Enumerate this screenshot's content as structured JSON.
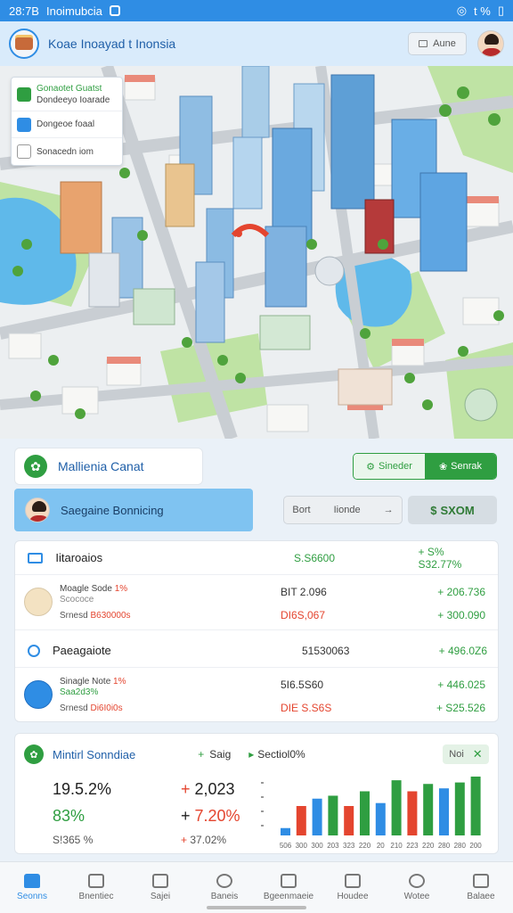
{
  "status_bar": {
    "time": "28:7B",
    "app_name": "Inoimubcia",
    "right_text": "t %"
  },
  "header": {
    "title": "Koae Inoayad t Inonsia",
    "button_label": "Aune"
  },
  "map_card": {
    "row1_top": "Gonaotet Guatst",
    "row1_bottom": "Dondeeyo Ioarade",
    "row2": "Dongeoe foaal",
    "row3": "Sonacedn iom"
  },
  "actions": {
    "card_label": "Mallienia Canat",
    "seg_left": "Sineder",
    "seg_right": "Senrak",
    "profile_label": "Saegaine Bonnicing",
    "ctl_left": "Bort",
    "ctl_mid": "Iionde",
    "ctl_right": "SXOM",
    "ctl_right_icon": "$"
  },
  "transactions": {
    "header1": {
      "name": "Iitaroaios",
      "mid": "S.S6600",
      "right": "+ S% S32.77%"
    },
    "item1": {
      "t1": "Moagle Sode",
      "t1_neg": "1%",
      "t2": "Scococe",
      "t3": "Srnesd",
      "t3_neg": "B630000s",
      "v1": "BIT 2.096",
      "v2": "DI6S,067",
      "r1": "+ 206.736",
      "r2": "+ 300.090"
    },
    "header2": {
      "name": "Paeagaiote",
      "mid": "51530063",
      "right": "+ 496.0Z6"
    },
    "item2": {
      "t1": "Sinagle Note",
      "t1_neg": "1%",
      "t2": "Saa2d3%",
      "t3": "Srnesd",
      "t3_neg": "Di6I0i0s",
      "v1": "5I6.5S60",
      "v2": "DIE S.S6S",
      "r1": "+ 446.025",
      "r2": "+ S25.526"
    }
  },
  "stats": {
    "title": "Mintirl Sonndiae",
    "h2": "Saig",
    "h3": "Sectiol0%",
    "chip": "Noi",
    "s1": "19.5.2%",
    "s2": "83%",
    "s3": "S!365 %",
    "s4": "2,023",
    "s5": "7.20%",
    "s6": "37.02%",
    "chart_ticks": [
      "506",
      "300",
      "300",
      "203",
      "323",
      "220",
      "20",
      "210",
      "223",
      "220",
      "280",
      "280",
      "200"
    ]
  },
  "chart_data": {
    "type": "bar",
    "categories": [
      "506",
      "300",
      "300",
      "203",
      "323",
      "220",
      "20",
      "210",
      "223",
      "220",
      "280",
      "280",
      "200"
    ],
    "values": [
      10,
      40,
      50,
      54,
      40,
      60,
      44,
      75,
      60,
      70,
      64,
      72,
      80
    ],
    "colors": [
      "#2f8de4",
      "#e4452f",
      "#2f8de4",
      "#2f9e41",
      "#e4452f",
      "#2f9e41",
      "#2f8de4",
      "#2f9e41",
      "#e4452f",
      "#2f9e41",
      "#2f8de4",
      "#2f9e41",
      "#2f9e41"
    ],
    "ylim": [
      0,
      80
    ]
  },
  "bottom_nav": [
    "Seonns",
    "Bnentiec",
    "Sajei",
    "Baneis",
    "Bgeenmaeie",
    "Houdee",
    "Wotee",
    "Balaee"
  ],
  "colors": {
    "accent_blue": "#2f8de4",
    "accent_green": "#2f9e41",
    "negative_red": "#e4452f"
  }
}
